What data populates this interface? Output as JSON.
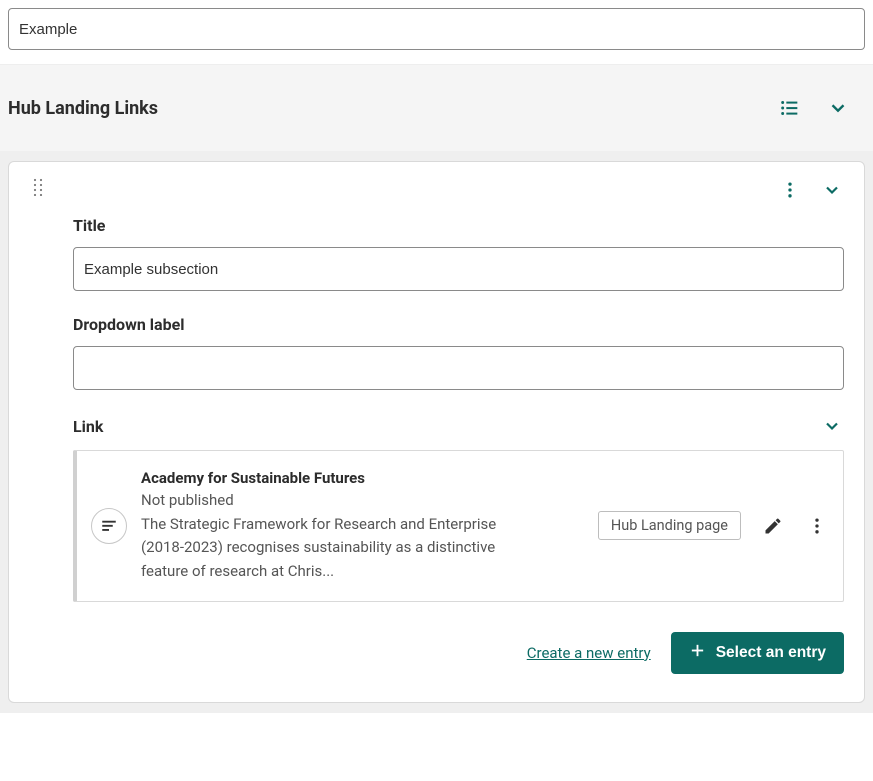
{
  "top_input_value": "Example",
  "section": {
    "title": "Hub Landing Links"
  },
  "card": {
    "title_label": "Title",
    "title_value": "Example subsection",
    "dropdown_label": "Dropdown label",
    "dropdown_value": "",
    "link_label": "Link",
    "entry": {
      "title": "Academy for Sustainable Futures",
      "status": "Not published",
      "excerpt": "The Strategic Framework for Research and Enterprise (2018-2023) recognises sustainability as a distinctive feature of research at Chris...",
      "tag": "Hub Landing page"
    }
  },
  "actions": {
    "create_label": "Create a new entry",
    "select_label": "Select an entry"
  },
  "colors": {
    "accent": "#0c6b64"
  }
}
